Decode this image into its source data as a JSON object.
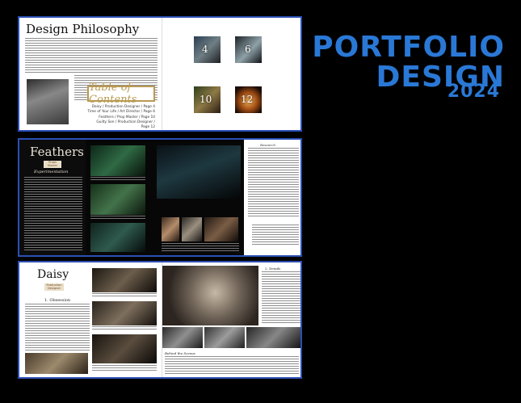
{
  "brand": {
    "line1": "PORTFOLIO",
    "line2": "DESIGN",
    "year": "2024",
    "color": "#2a78d6"
  },
  "spread1": {
    "heading": "Design Philosophy",
    "toc_title": "Table of Contents",
    "toc_items": [
      "Daisy / Production Designer / Page 4",
      "Time of Your Life / Art Director / Page 6",
      "Feathers / Prop Master / Page 10",
      "Guilty Son / Production Designer / Page 12"
    ],
    "tile_numbers": [
      "4",
      "6",
      "10",
      "12"
    ]
  },
  "spread2": {
    "title": "Feathers",
    "tag_line1": "Props",
    "tag_line2": "Master",
    "subtitle": "Experimentation",
    "section_label": "Research"
  },
  "spread3": {
    "title": "Daisy",
    "tag_line1": "Production",
    "tag_line2": "Designer",
    "section1": "1. Obsession",
    "section2": "2. Details",
    "section3": "Behind the Scenes"
  },
  "colors": {
    "frame_border": "#2b4fb4",
    "gold": "#b99a54"
  }
}
